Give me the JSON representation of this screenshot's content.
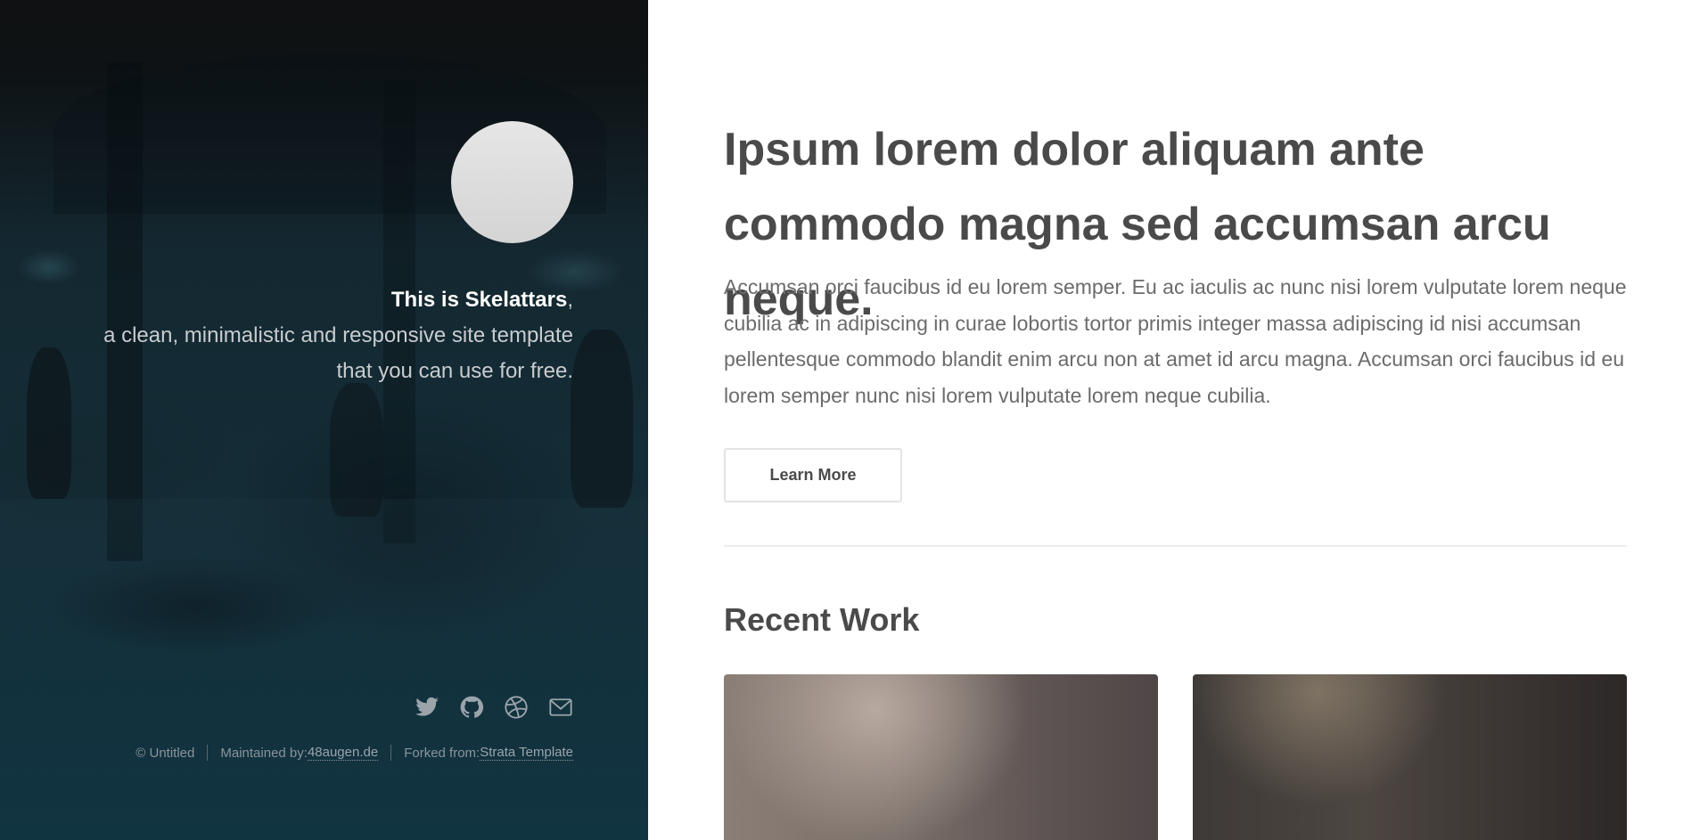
{
  "header": {
    "intro": {
      "name_strong": "This is Skelattars",
      "name_suffix": ",",
      "line2": "a clean, minimalistic and responsive site template",
      "line3": "that you can use for free."
    },
    "social": [
      {
        "icon": "twitter-icon"
      },
      {
        "icon": "github-icon"
      },
      {
        "icon": "dribbble-icon"
      },
      {
        "icon": "envelope-icon"
      }
    ],
    "copyright": {
      "copy": "© Untitled",
      "maintained_label": "Maintained by: ",
      "maintained_link": "48augen.de",
      "forked_label": "Forked from: ",
      "forked_link": "Strata Template"
    }
  },
  "main": {
    "headline": "Ipsum lorem dolor aliquam ante commodo magna sed accumsan arcu neque.",
    "lead": "Accumsan orci faucibus id eu lorem semper. Eu ac iaculis ac nunc nisi lorem vulputate lorem neque cubilia ac in adipiscing in curae lobortis tortor primis integer massa adipiscing id nisi accumsan pellentesque commodo blandit enim arcu non at amet id arcu magna. Accumsan orci faucibus id eu lorem semper nunc nisi lorem vulputate lorem neque cubilia.",
    "button_label": "Learn More",
    "section_title": "Recent Work"
  },
  "colors": {
    "header_bg": "#12313d",
    "text_dark": "#4a4a4a",
    "text_body": "#6b6b6b",
    "icon_color": "#9aa4aa"
  }
}
